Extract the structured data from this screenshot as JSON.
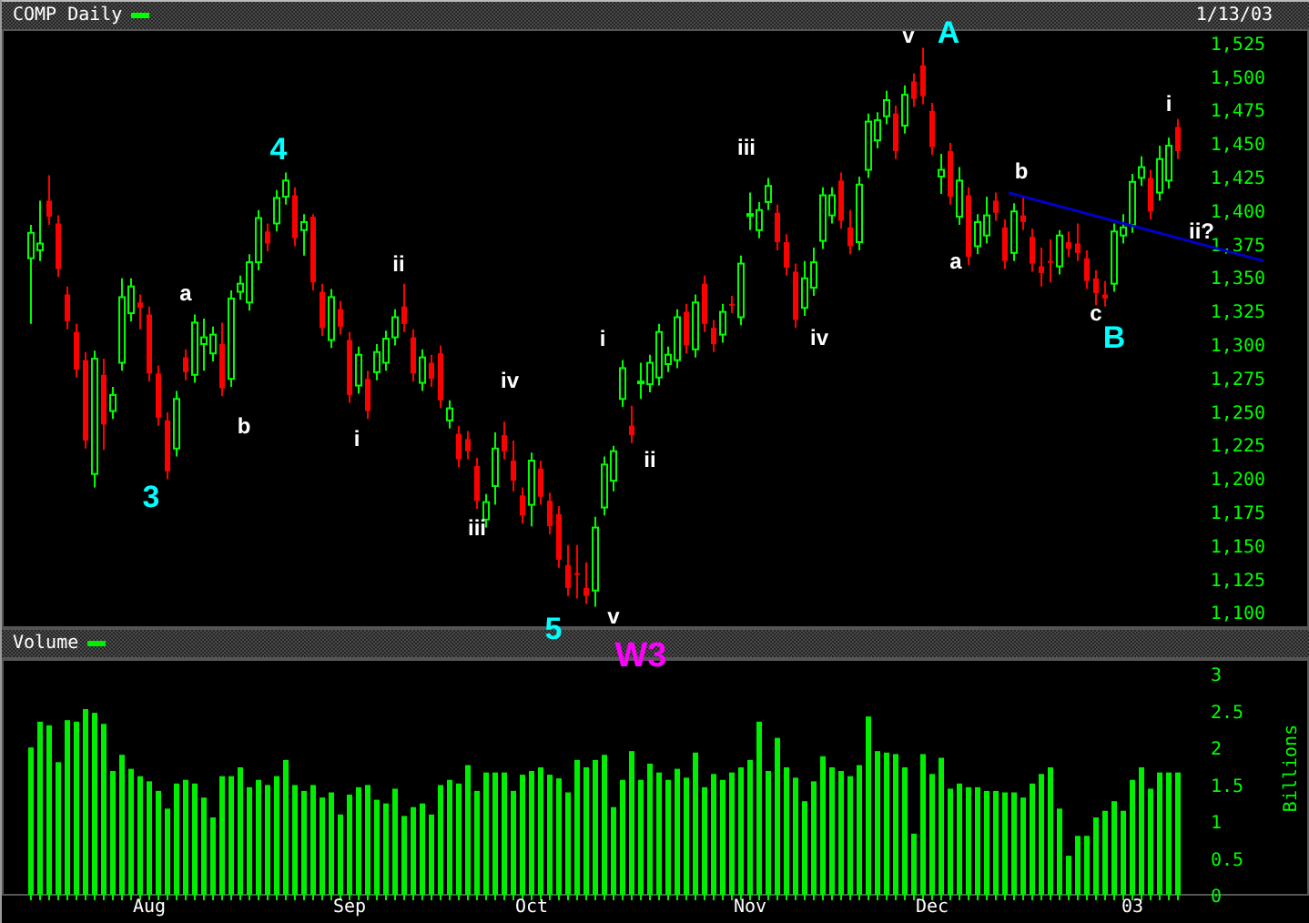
{
  "header": {
    "title": "COMP Daily",
    "date": "1/13/03"
  },
  "price_panel": {
    "chart_data": {
      "type": "candlestick",
      "ylim": [
        1088,
        1535
      ],
      "categories": [
        null,
        null,
        null,
        null,
        null,
        null,
        null,
        null,
        null,
        null,
        null,
        null,
        null,
        null,
        null,
        null,
        null,
        null,
        null,
        null,
        null,
        null,
        null,
        null,
        null,
        null,
        null,
        null,
        null,
        null,
        null,
        null,
        null,
        null,
        null,
        null,
        null,
        null,
        null,
        null,
        null,
        null,
        null,
        null,
        null,
        null,
        null,
        null,
        null,
        null,
        null,
        null,
        null,
        null,
        null,
        null,
        null,
        null,
        null,
        null,
        null,
        null,
        null,
        null,
        null,
        null,
        null,
        null,
        null,
        null,
        null,
        null,
        null,
        null,
        null,
        null,
        null,
        null,
        null,
        null,
        null,
        null,
        null,
        null,
        null,
        null,
        null,
        null,
        null,
        null,
        null,
        null,
        null,
        null,
        null,
        null,
        null,
        null,
        null,
        null,
        null,
        null,
        null,
        null,
        null,
        null,
        null,
        null,
        null,
        null,
        null,
        null,
        null,
        null,
        null,
        null,
        null,
        null,
        null,
        null,
        null,
        null,
        null,
        null,
        null,
        null,
        null
      ],
      "yticks": [
        {
          "value": 1100,
          "label": "1,100"
        },
        {
          "value": 1125,
          "label": "1,125"
        },
        {
          "value": 1150,
          "label": "1,150"
        },
        {
          "value": 1175,
          "label": "1,175"
        },
        {
          "value": 1200,
          "label": "1,200"
        },
        {
          "value": 1225,
          "label": "1,225"
        },
        {
          "value": 1250,
          "label": "1,250"
        },
        {
          "value": 1275,
          "label": "1,275"
        },
        {
          "value": 1300,
          "label": "1,300"
        },
        {
          "value": 1325,
          "label": "1,325"
        },
        {
          "value": 1350,
          "label": "1,350"
        },
        {
          "value": 1375,
          "label": "1,375"
        },
        {
          "value": 1400,
          "label": "1,400"
        },
        {
          "value": 1425,
          "label": "1,425"
        },
        {
          "value": 1450,
          "label": "1,450"
        },
        {
          "value": 1475,
          "label": "1,475"
        },
        {
          "value": 1500,
          "label": "1,500"
        },
        {
          "value": 1525,
          "label": "1,525"
        }
      ],
      "ohlc": [
        [
          1364,
          1389,
          1315,
          1383
        ],
        [
          1370,
          1407,
          1362,
          1375
        ],
        [
          1407,
          1426,
          1389,
          1395
        ],
        [
          1390,
          1396,
          1350,
          1356
        ],
        [
          1337,
          1343,
          1311,
          1317
        ],
        [
          1309,
          1315,
          1275,
          1281
        ],
        [
          1288,
          1294,
          1222,
          1228
        ],
        [
          1203,
          1295,
          1193,
          1289
        ],
        [
          1277,
          1289,
          1221,
          1240
        ],
        [
          1250,
          1268,
          1244,
          1262
        ],
        [
          1286,
          1349,
          1280,
          1335
        ],
        [
          1323,
          1349,
          1317,
          1343
        ],
        [
          1331,
          1337,
          1311,
          1327
        ],
        [
          1322,
          1328,
          1272,
          1278
        ],
        [
          1278,
          1284,
          1239,
          1245
        ],
        [
          1243,
          1249,
          1199,
          1205
        ],
        [
          1222,
          1265,
          1216,
          1259
        ],
        [
          1290,
          1296,
          1273,
          1279
        ],
        [
          1277,
          1322,
          1271,
          1316
        ],
        [
          1300,
          1319,
          1280,
          1305
        ],
        [
          1293,
          1313,
          1287,
          1307
        ],
        [
          1300,
          1316,
          1261,
          1267
        ],
        [
          1274,
          1340,
          1268,
          1334
        ],
        [
          1339,
          1351,
          1333,
          1345
        ],
        [
          1331,
          1367,
          1325,
          1361
        ],
        [
          1361,
          1400,
          1355,
          1394
        ],
        [
          1384,
          1390,
          1369,
          1375
        ],
        [
          1390,
          1415,
          1384,
          1409
        ],
        [
          1410,
          1428,
          1404,
          1422
        ],
        [
          1411,
          1417,
          1373,
          1379
        ],
        [
          1385,
          1397,
          1366,
          1391
        ],
        [
          1395,
          1397,
          1340,
          1346
        ],
        [
          1339,
          1345,
          1306,
          1312
        ],
        [
          1303,
          1341,
          1297,
          1335
        ],
        [
          1326,
          1332,
          1307,
          1313
        ],
        [
          1303,
          1309,
          1256,
          1262
        ],
        [
          1269,
          1298,
          1263,
          1292
        ],
        [
          1274,
          1280,
          1244,
          1250
        ],
        [
          1279,
          1300,
          1273,
          1294
        ],
        [
          1286,
          1310,
          1280,
          1304
        ],
        [
          1305,
          1326,
          1299,
          1320
        ],
        [
          1328,
          1345,
          1309,
          1315
        ],
        [
          1305,
          1311,
          1272,
          1278
        ],
        [
          1271,
          1296,
          1265,
          1290
        ],
        [
          1286,
          1292,
          1268,
          1274
        ],
        [
          1293,
          1299,
          1252,
          1258
        ],
        [
          1243,
          1258,
          1237,
          1252
        ],
        [
          1233,
          1239,
          1208,
          1214
        ],
        [
          1229,
          1235,
          1214,
          1220
        ],
        [
          1209,
          1215,
          1177,
          1183
        ],
        [
          1169,
          1188,
          1163,
          1182
        ],
        [
          1194,
          1234,
          1180,
          1222
        ],
        [
          1232,
          1242,
          1214,
          1220
        ],
        [
          1213,
          1228,
          1190,
          1198
        ],
        [
          1187,
          1193,
          1166,
          1172
        ],
        [
          1180,
          1219,
          1164,
          1213
        ],
        [
          1207,
          1213,
          1180,
          1186
        ],
        [
          1183,
          1189,
          1158,
          1164
        ],
        [
          1173,
          1179,
          1133,
          1139
        ],
        [
          1135,
          1150,
          1112,
          1118
        ],
        [
          1129,
          1150,
          1110,
          1128
        ],
        [
          1118,
          1137,
          1106,
          1112
        ],
        [
          1116,
          1171,
          1104,
          1163
        ],
        [
          1178,
          1216,
          1172,
          1210
        ],
        [
          1198,
          1224,
          1190,
          1220
        ],
        [
          1259,
          1288,
          1253,
          1282
        ],
        [
          1239,
          1254,
          1226,
          1232
        ],
        [
          1271,
          1286,
          1259,
          1272
        ],
        [
          1270,
          1292,
          1264,
          1286
        ],
        [
          1275,
          1315,
          1269,
          1309
        ],
        [
          1285,
          1298,
          1279,
          1292
        ],
        [
          1288,
          1326,
          1282,
          1320
        ],
        [
          1324,
          1330,
          1293,
          1299
        ],
        [
          1296,
          1337,
          1290,
          1331
        ],
        [
          1345,
          1351,
          1309,
          1315
        ],
        [
          1312,
          1318,
          1294,
          1300
        ],
        [
          1307,
          1330,
          1301,
          1324
        ],
        [
          1330,
          1336,
          1323,
          1329
        ],
        [
          1320,
          1366,
          1314,
          1360
        ],
        [
          1396,
          1413,
          1385,
          1397
        ],
        [
          1385,
          1406,
          1379,
          1400
        ],
        [
          1406,
          1424,
          1400,
          1418
        ],
        [
          1398,
          1404,
          1370,
          1376
        ],
        [
          1376,
          1382,
          1351,
          1357
        ],
        [
          1354,
          1360,
          1312,
          1318
        ],
        [
          1327,
          1362,
          1321,
          1349
        ],
        [
          1342,
          1372,
          1336,
          1361
        ],
        [
          1377,
          1417,
          1371,
          1411
        ],
        [
          1396,
          1417,
          1390,
          1411
        ],
        [
          1422,
          1428,
          1386,
          1392
        ],
        [
          1387,
          1400,
          1367,
          1373
        ],
        [
          1376,
          1425,
          1370,
          1419
        ],
        [
          1430,
          1472,
          1424,
          1466
        ],
        [
          1452,
          1473,
          1446,
          1467
        ],
        [
          1470,
          1489,
          1464,
          1482
        ],
        [
          1472,
          1478,
          1438,
          1444
        ],
        [
          1463,
          1493,
          1457,
          1486
        ],
        [
          1496,
          1502,
          1477,
          1483
        ],
        [
          1508,
          1521,
          1479,
          1485
        ],
        [
          1474,
          1480,
          1441,
          1447
        ],
        [
          1425,
          1442,
          1412,
          1430
        ],
        [
          1444,
          1450,
          1404,
          1410
        ],
        [
          1395,
          1432,
          1389,
          1422
        ],
        [
          1411,
          1417,
          1359,
          1365
        ],
        [
          1373,
          1397,
          1367,
          1391
        ],
        [
          1381,
          1410,
          1375,
          1396
        ],
        [
          1407,
          1413,
          1392,
          1398
        ],
        [
          1387,
          1393,
          1356,
          1362
        ],
        [
          1368,
          1405,
          1362,
          1399
        ],
        [
          1396,
          1410,
          1385,
          1391
        ],
        [
          1380,
          1386,
          1354,
          1360
        ],
        [
          1358,
          1372,
          1343,
          1353
        ],
        [
          1362,
          1378,
          1346,
          1361
        ],
        [
          1358,
          1385,
          1352,
          1381
        ],
        [
          1376,
          1384,
          1365,
          1371
        ],
        [
          1375,
          1390,
          1362,
          1368
        ],
        [
          1364,
          1370,
          1341,
          1347
        ],
        [
          1349,
          1355,
          1329,
          1338
        ],
        [
          1337,
          1347,
          1328,
          1334
        ],
        [
          1345,
          1390,
          1339,
          1384
        ],
        [
          1381,
          1397,
          1375,
          1387
        ],
        [
          1389,
          1427,
          1383,
          1421
        ],
        [
          1424,
          1440,
          1418,
          1432
        ],
        [
          1424,
          1430,
          1393,
          1399
        ],
        [
          1413,
          1448,
          1407,
          1438
        ],
        [
          1422,
          1454,
          1416,
          1448
        ],
        [
          1462,
          1468,
          1438,
          1444
        ]
      ]
    },
    "wave_labels": [
      {
        "text": "3",
        "color": "#00ffff"
      },
      {
        "text": "a",
        "color": "#ffffff"
      },
      {
        "text": "b",
        "color": "#ffffff"
      },
      {
        "text": "4",
        "color": "#00ffff"
      },
      {
        "text": "i",
        "color": "#ffffff"
      },
      {
        "text": "ii",
        "color": "#ffffff"
      },
      {
        "text": "iii",
        "color": "#ffffff"
      },
      {
        "text": "iv",
        "color": "#ffffff"
      },
      {
        "text": "5",
        "color": "#00ffff"
      },
      {
        "text": "i",
        "color": "#ffffff"
      },
      {
        "text": "ii",
        "color": "#ffffff"
      },
      {
        "text": "v",
        "color": "#ffffff"
      },
      {
        "text": "W3",
        "color": "#ff00ff"
      },
      {
        "text": "iii",
        "color": "#ffffff"
      },
      {
        "text": "iv",
        "color": "#ffffff"
      },
      {
        "text": "v",
        "color": "#ffffff"
      },
      {
        "text": "A",
        "color": "#00ffff"
      },
      {
        "text": "a",
        "color": "#ffffff"
      },
      {
        "text": "b",
        "color": "#ffffff"
      },
      {
        "text": "c",
        "color": "#ffffff"
      },
      {
        "text": "B",
        "color": "#00ffff"
      },
      {
        "text": "i",
        "color": "#ffffff"
      },
      {
        "text": "ii?",
        "color": "#ffffff"
      }
    ]
  },
  "volume_panel": {
    "chart_data": {
      "type": "bar",
      "ylabel": "Billions",
      "ylim": [
        0,
        3.2
      ],
      "categories": [
        null,
        null,
        null,
        null,
        null,
        null,
        null,
        null,
        null,
        null,
        null,
        null,
        null,
        "Aug",
        null,
        null,
        null,
        null,
        null,
        null,
        null,
        null,
        null,
        null,
        null,
        null,
        null,
        null,
        null,
        null,
        null,
        null,
        null,
        null,
        null,
        "Sep",
        null,
        null,
        null,
        null,
        null,
        null,
        null,
        null,
        null,
        null,
        null,
        null,
        null,
        null,
        null,
        null,
        null,
        null,
        null,
        "Oct",
        null,
        null,
        null,
        null,
        null,
        null,
        null,
        null,
        null,
        null,
        null,
        null,
        null,
        null,
        null,
        null,
        null,
        null,
        null,
        null,
        null,
        null,
        null,
        "Nov",
        null,
        null,
        null,
        null,
        null,
        null,
        null,
        null,
        null,
        null,
        null,
        null,
        null,
        null,
        null,
        null,
        null,
        null,
        null,
        "Dec",
        null,
        null,
        null,
        null,
        null,
        null,
        null,
        null,
        null,
        null,
        null,
        null,
        null,
        null,
        null,
        null,
        null,
        null,
        null,
        null,
        null,
        "03",
        null,
        null,
        null,
        null,
        null
      ],
      "yticks": [
        0,
        0.5,
        1,
        1.5,
        2,
        2.5,
        3
      ],
      "series": [
        {
          "name": "Volume",
          "color": "#00ee00",
          "values": [
            2.0,
            2.35,
            2.3,
            1.8,
            2.37,
            2.35,
            2.52,
            2.47,
            2.32,
            1.68,
            1.9,
            1.71,
            1.61,
            1.54,
            1.41,
            1.17,
            1.51,
            1.56,
            1.51,
            1.32,
            1.05,
            1.61,
            1.61,
            1.73,
            1.46,
            1.56,
            1.49,
            1.61,
            1.83,
            1.49,
            1.41,
            1.49,
            1.32,
            1.39,
            1.09,
            1.36,
            1.46,
            1.49,
            1.29,
            1.24,
            1.44,
            1.07,
            1.19,
            1.24,
            1.09,
            1.49,
            1.56,
            1.51,
            1.76,
            1.41,
            1.66,
            1.66,
            1.66,
            1.41,
            1.63,
            1.68,
            1.73,
            1.63,
            1.58,
            1.39,
            1.83,
            1.73,
            1.83,
            1.9,
            1.19,
            1.56,
            1.95,
            1.56,
            1.78,
            1.66,
            1.56,
            1.71,
            1.59,
            1.93,
            1.46,
            1.64,
            1.56,
            1.66,
            1.73,
            1.83,
            2.35,
            1.68,
            2.13,
            1.73,
            1.59,
            1.27,
            1.54,
            1.88,
            1.73,
            1.68,
            1.61,
            1.76,
            2.42,
            1.95,
            1.93,
            1.91,
            1.73,
            0.83,
            1.91,
            1.64,
            1.86,
            1.44,
            1.51,
            1.46,
            1.46,
            1.41,
            1.41,
            1.39,
            1.39,
            1.32,
            1.51,
            1.64,
            1.73,
            1.17,
            0.53,
            0.8,
            0.8,
            1.05,
            1.14,
            1.27,
            1.14,
            1.56,
            1.73,
            1.44,
            1.66,
            1.66,
            1.66
          ]
        }
      ]
    }
  }
}
